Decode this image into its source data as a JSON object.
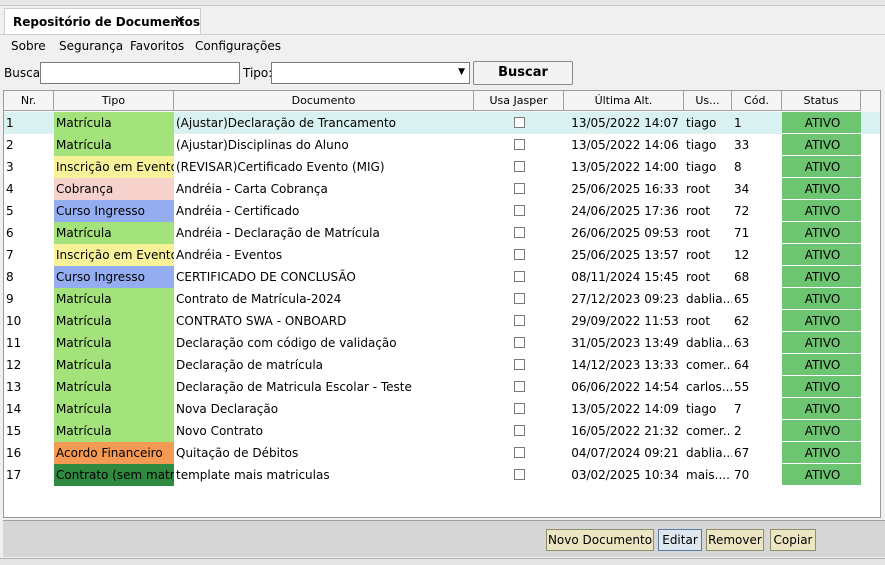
{
  "tab": {
    "title": "Repositório de Documentos",
    "close_label": "✕"
  },
  "menu": [
    "Sobre",
    "Segurança",
    "Favoritos",
    "Configurações"
  ],
  "search": {
    "busca_label": "Busca:",
    "busca_value": "",
    "tipo_label": "Tipo:",
    "tipo_value": "",
    "button": "Buscar"
  },
  "columns": [
    "Nr.",
    "Tipo",
    "Documento",
    "Usa Jasper",
    "Última Alt.",
    "Us...",
    "Cód.",
    "Status"
  ],
  "colors": {
    "Matrícula": "#a4e27c",
    "Inscrição em Eventos": "#f7f29a",
    "Cobrança": "#f7d2cd",
    "Curso Ingresso": "#93adf0",
    "Acordo Financeiro": "#f59a55",
    "Contrato (sem matrí...": "#2f8a40",
    "selected_row": "#d9f1f0",
    "status": "#6dc471"
  },
  "rows": [
    {
      "nr": "1",
      "tipo": "Matrícula",
      "documento": "(Ajustar)Declaração de Trancamento",
      "data": "13/05/2022 14:07",
      "usuario": "tiago",
      "cod": "1",
      "status": "ATIVO"
    },
    {
      "nr": "2",
      "tipo": "Matrícula",
      "documento": "(Ajustar)Disciplinas do Aluno",
      "data": "13/05/2022 14:06",
      "usuario": "tiago",
      "cod": "33",
      "status": "ATIVO"
    },
    {
      "nr": "3",
      "tipo": "Inscrição em Eventos",
      "documento": "(REVISAR)Certificado Evento (MIG)",
      "data": "13/05/2022 14:00",
      "usuario": "tiago",
      "cod": "8",
      "status": "ATIVO"
    },
    {
      "nr": "4",
      "tipo": "Cobrança",
      "documento": "Andréia - Carta Cobrança",
      "data": "25/06/2025 16:33",
      "usuario": "root",
      "cod": "34",
      "status": "ATIVO"
    },
    {
      "nr": "5",
      "tipo": "Curso Ingresso",
      "documento": "Andréia - Certificado",
      "data": "24/06/2025 17:36",
      "usuario": "root",
      "cod": "72",
      "status": "ATIVO"
    },
    {
      "nr": "6",
      "tipo": "Matrícula",
      "documento": "Andréia - Declaração de Matrícula",
      "data": "26/06/2025 09:53",
      "usuario": "root",
      "cod": "71",
      "status": "ATIVO"
    },
    {
      "nr": "7",
      "tipo": "Inscrição em Eventos",
      "documento": "Andréia - Eventos",
      "data": "25/06/2025 13:57",
      "usuario": "root",
      "cod": "12",
      "status": "ATIVO"
    },
    {
      "nr": "8",
      "tipo": "Curso Ingresso",
      "documento": "CERTIFICADO DE CONCLUSÃO",
      "data": "08/11/2024 15:45",
      "usuario": "root",
      "cod": "68",
      "status": "ATIVO"
    },
    {
      "nr": "9",
      "tipo": "Matrícula",
      "documento": "Contrato de Matrícula-2024",
      "data": "27/12/2023 09:23",
      "usuario": "dablia...",
      "cod": "65",
      "status": "ATIVO"
    },
    {
      "nr": "10",
      "tipo": "Matrícula",
      "documento": "CONTRATO SWA - ONBOARD",
      "data": "29/09/2022 11:53",
      "usuario": "root",
      "cod": "62",
      "status": "ATIVO"
    },
    {
      "nr": "11",
      "tipo": "Matrícula",
      "documento": "Declaração com código de validação",
      "data": "31/05/2023 13:49",
      "usuario": "dablia...",
      "cod": "63",
      "status": "ATIVO"
    },
    {
      "nr": "12",
      "tipo": "Matrícula",
      "documento": "Declaração de matrícula",
      "data": "14/12/2023 13:33",
      "usuario": "comer...",
      "cod": "64",
      "status": "ATIVO"
    },
    {
      "nr": "13",
      "tipo": "Matrícula",
      "documento": "Declaração de Matricula Escolar - Teste",
      "data": "06/06/2022 14:54",
      "usuario": "carlos...",
      "cod": "55",
      "status": "ATIVO"
    },
    {
      "nr": "14",
      "tipo": "Matrícula",
      "documento": "Nova Declaração",
      "data": "13/05/2022 14:09",
      "usuario": "tiago",
      "cod": "7",
      "status": "ATIVO"
    },
    {
      "nr": "15",
      "tipo": "Matrícula",
      "documento": "Novo Contrato",
      "data": "16/05/2022 21:32",
      "usuario": "comer...",
      "cod": "2",
      "status": "ATIVO"
    },
    {
      "nr": "16",
      "tipo": "Acordo Financeiro",
      "documento": "Quitação de Débitos",
      "data": "04/07/2024 09:21",
      "usuario": "dablia...",
      "cod": "67",
      "status": "ATIVO"
    },
    {
      "nr": "17",
      "tipo": "Contrato (sem matrí...",
      "documento": "template mais matriculas",
      "data": "03/02/2025 10:34",
      "usuario": "mais....",
      "cod": "70",
      "status": "ATIVO"
    }
  ],
  "buttons": {
    "novo": "Novo Documento",
    "editar": "Editar",
    "remover": "Remover",
    "copiar": "Copiar"
  }
}
